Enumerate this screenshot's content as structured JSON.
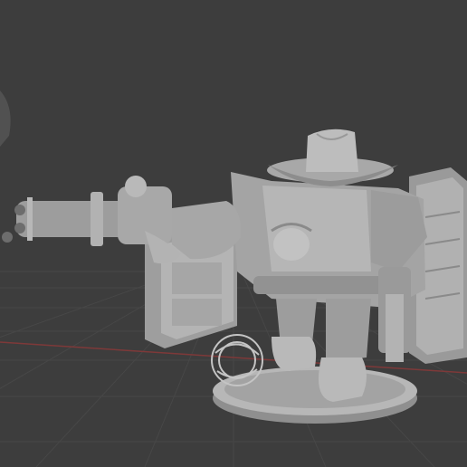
{
  "app": {
    "name": "3D viewport",
    "view": "perspective"
  },
  "viewport": {
    "background_color": "#3d3d3d",
    "grid_color": "#4a4a4a",
    "x_axis_color": "#8a3a3a",
    "model_color": "#a9a9a9",
    "model_shadow_color": "#7d7d7d",
    "model_highlight_color": "#c9c9c9",
    "base_color": "#b8b8b8"
  },
  "scene": {
    "objects": [
      {
        "name": "cowboy-mech-miniature",
        "icon": "mesh-object"
      },
      {
        "name": "gatling-gun",
        "icon": "mesh-object"
      },
      {
        "name": "saloon-door-left",
        "icon": "mesh-object"
      },
      {
        "name": "saloon-door-right",
        "icon": "mesh-object"
      },
      {
        "name": "round-base",
        "icon": "mesh-object"
      },
      {
        "name": "tumbleweed",
        "icon": "mesh-object"
      },
      {
        "name": "offscreen-object-edge",
        "icon": "mesh-object"
      }
    ]
  }
}
